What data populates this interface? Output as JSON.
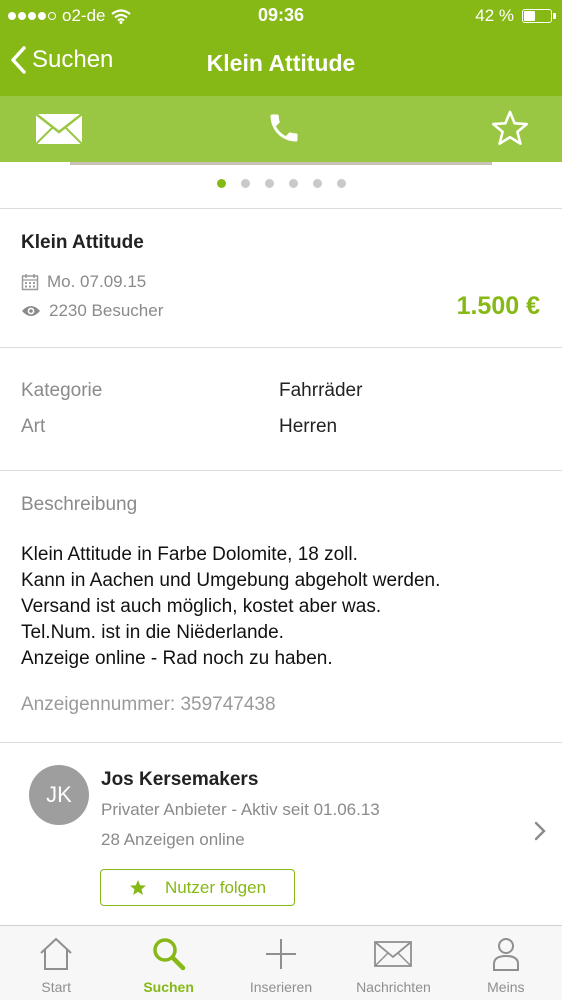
{
  "status_bar": {
    "carrier": "o2-de",
    "time": "09:36",
    "battery": "42 %",
    "battery_level": 0.42,
    "signal_bars": 4
  },
  "nav": {
    "back_label": "Suchen",
    "title": "Klein Attitude"
  },
  "actions": [
    "mail-icon",
    "phone-icon",
    "star-icon"
  ],
  "gallery": {
    "image_count": 6,
    "active_index": 0
  },
  "listing": {
    "title": "Klein Attitude",
    "date": "Mo. 07.09.15",
    "visitors": "2230 Besucher",
    "price": "1.500 €"
  },
  "attributes": [
    {
      "label": "Kategorie",
      "value": "Fahrräder"
    },
    {
      "label": "Art",
      "value": "Herren"
    }
  ],
  "description": {
    "heading": "Beschreibung",
    "lines": [
      "Klein Attitude in Farbe Dolomite, 18 zoll.",
      "Kann in Aachen und Umgebung abgeholt werden.",
      "Versand ist auch möglich, kostet aber was.",
      "Tel.Num. ist in die Niëderlande.",
      "Anzeige online - Rad noch zu haben."
    ],
    "ad_number": "Anzeigennummer: 359747438"
  },
  "seller": {
    "initials": "JK",
    "name": "Jos Kersemakers",
    "type": "Privater Anbieter - Aktiv seit 01.06.13",
    "ads_online": "28 Anzeigen online",
    "follow_label": "Nutzer folgen"
  },
  "tabs": [
    {
      "label": "Start",
      "icon": "home-icon"
    },
    {
      "label": "Suchen",
      "icon": "search-icon",
      "active": true
    },
    {
      "label": "Inserieren",
      "icon": "plus-icon"
    },
    {
      "label": "Nachrichten",
      "icon": "mail-icon"
    },
    {
      "label": "Meins",
      "icon": "user-icon"
    }
  ],
  "colors": {
    "brand": "#86b816",
    "action_bar": "#99c743"
  }
}
